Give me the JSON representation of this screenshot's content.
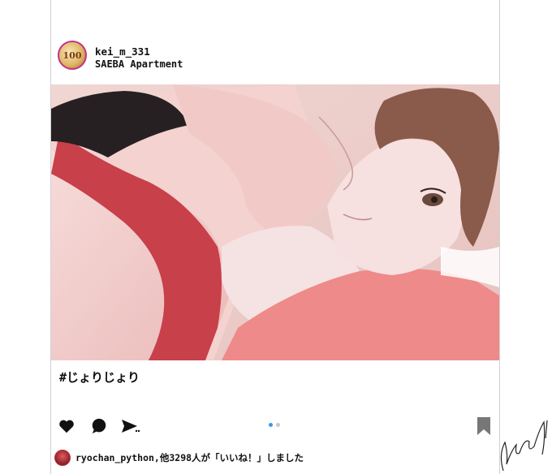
{
  "post": {
    "username": "kei_m_331",
    "location": "SAEBA Apartment",
    "avatar_text": "100",
    "caption": "#じょりじょり",
    "likes_text": "ryochan_python,他3298人が「いいね！」しました"
  },
  "carousel": {
    "total": 2,
    "active_index": 0
  },
  "icons": [
    "heart-icon",
    "comment-icon",
    "share-icon",
    "bookmark-icon"
  ],
  "colors": {
    "accent": "#3897f0",
    "avatar_ring": "#c13584"
  }
}
